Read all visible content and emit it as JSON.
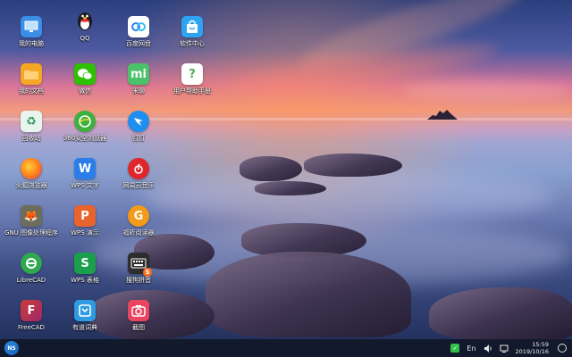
{
  "desktop_icons": [
    {
      "label": "我的电脑",
      "icon": "computer-icon",
      "color": "#3a8ee6"
    },
    {
      "label": "QQ",
      "icon": "qq-penguin-icon",
      "color": "#1b1b1b"
    },
    {
      "label": "百度网盘",
      "icon": "baidu-netdisk-icon",
      "color": "#ffffff"
    },
    {
      "label": "软件中心",
      "icon": "software-center-bag-icon",
      "color": "#2ea3f2"
    },
    {
      "label": "我的文档",
      "icon": "folder-icon",
      "color": "#f5a623"
    },
    {
      "label": "微信",
      "icon": "wechat-icon",
      "color": "#2dc100"
    },
    {
      "label": "米聊",
      "icon": "mitalk-icon",
      "color": "#4cc16b"
    },
    {
      "label": "用户帮助手册",
      "icon": "user-help-icon",
      "color": "#4bb04f"
    },
    {
      "label": "回收站",
      "icon": "recycle-bin-icon",
      "color": "#e8f4ee"
    },
    {
      "label": "360安全浏览器",
      "icon": "360-browser-icon",
      "color": "#3db13d"
    },
    {
      "label": "钉钉",
      "icon": "dingtalk-icon",
      "color": "#1e8ff0"
    },
    {
      "label": "火狐浏览器",
      "icon": "firefox-icon",
      "color": "#ff7a1a"
    },
    {
      "label": "WPS 文字",
      "icon": "wps-writer-icon",
      "color": "#2b7de9"
    },
    {
      "label": "网易云音乐",
      "icon": "netease-music-icon",
      "color": "#e0262a"
    },
    {
      "label": "GNU 图像处理程序",
      "icon": "gimp-icon",
      "color": "#6d6d5b"
    },
    {
      "label": "WPS 演示",
      "icon": "wps-presentation-icon",
      "color": "#e8642c"
    },
    {
      "label": "福昕阅读器",
      "icon": "foxit-reader-icon",
      "color": "#f29b18"
    },
    {
      "label": "LibreCAD",
      "icon": "librecad-icon",
      "color": "#2fa84f"
    },
    {
      "label": "WPS 表格",
      "icon": "wps-spreadsheet-icon",
      "color": "#1aa04c"
    },
    {
      "label": "搜狗拼音",
      "icon": "sogou-pinyin-icon",
      "color": "#2d2d2d"
    },
    {
      "label": "FreeCAD",
      "icon": "freecad-icon",
      "color": "#d03a3a"
    },
    {
      "label": "有道词典",
      "icon": "youdao-dict-icon",
      "color": "#2f9be3"
    },
    {
      "label": "截图",
      "icon": "screenshot-camera-icon",
      "color": "#e94560"
    }
  ],
  "taskbar": {
    "start_label": "NS",
    "input_method": "En",
    "time": "15:59",
    "date": "2019/10/16"
  }
}
